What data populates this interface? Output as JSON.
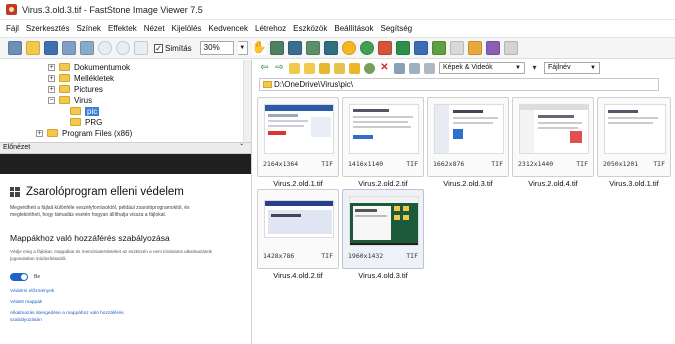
{
  "window": {
    "title": "Virus.3.old.3.tif - FastStone Image Viewer 7.5"
  },
  "menu": [
    "Fájl",
    "Szerkesztés",
    "Színek",
    "Effektek",
    "Nézet",
    "Kijelölés",
    "Kedvencek",
    "Létrehoz",
    "Eszközök",
    "Beállítások",
    "Segítség"
  ],
  "toolbar": {
    "smooth_label": "Simítás",
    "zoom_value": "30%"
  },
  "tree": {
    "items": [
      {
        "label": "Dokumentumok"
      },
      {
        "label": "Mellékletek"
      },
      {
        "label": "Pictures"
      },
      {
        "label": "Virus"
      },
      {
        "label": "pic"
      },
      {
        "label": "PRG"
      },
      {
        "label": "Program Files (x86)"
      }
    ]
  },
  "preview": {
    "header": "Előnézet",
    "title": "Zsarolóprogram elleni védelem",
    "desc": "Megvédheti a fájlait különféle veszélyforrásoktól, például zsarolóprogramoktól, és megtekintheti, hogy támadás esetén hogyan állíthatja vissza a fájlokat.",
    "subtitle": "Mappákhoz való hozzáférés szabályozása",
    "desc2": "Védje meg a fájlokat, mappákat és memóriaterületeket az eszközén a nem kívánatos alkalmazások jogosulatlan módosításaitól.",
    "toggle_label": "Be",
    "links": [
      "Védett mappák",
      "Alkalmazás átengedése a mappához való hozzáférés szabályozásán"
    ],
    "link_top": "Védelmi előzmények"
  },
  "filter": {
    "type": "Képek & Videók",
    "sort": "Fájlnév"
  },
  "path": "D:\\OneDrive\\Virus\\pic\\",
  "thumbnails": [
    {
      "name": "Virus.2.old.1.tif",
      "dims": "2164x1364",
      "ext": "TIF"
    },
    {
      "name": "Virus.2.old.2.tif",
      "dims": "1416x1140",
      "ext": "TIF"
    },
    {
      "name": "Virus.2.old.3.tif",
      "dims": "1662x876",
      "ext": "TIF"
    },
    {
      "name": "Virus.2.old.4.tif",
      "dims": "2312x1440",
      "ext": "TIF"
    },
    {
      "name": "Virus.3.old.1.tif",
      "dims": "2050x1201",
      "ext": "TIF"
    },
    {
      "name": "Virus.4.old.2.tif",
      "dims": "1428x786",
      "ext": "TIF"
    },
    {
      "name": "Virus.4.old.3.tif",
      "dims": "1960x1432",
      "ext": "TIF"
    }
  ]
}
